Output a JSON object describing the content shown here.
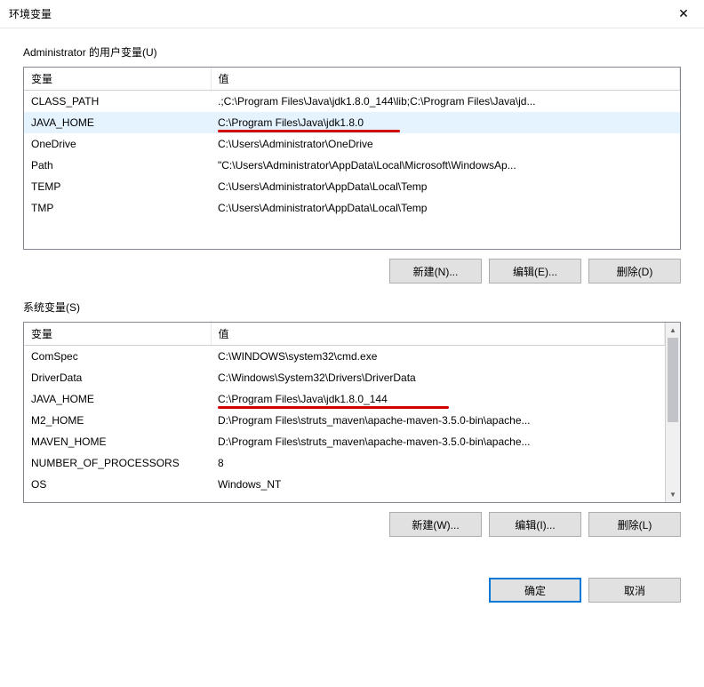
{
  "titlebar": {
    "title": "环境变量"
  },
  "userSection": {
    "label": "Administrator 的用户变量(U)",
    "columns": {
      "var": "变量",
      "val": "值"
    },
    "rows": [
      {
        "var": "CLASS_PATH",
        "val": ".;C:\\Program Files\\Java\\jdk1.8.0_144\\lib;C:\\Program Files\\Java\\jd..."
      },
      {
        "var": "JAVA_HOME",
        "val": "C:\\Program Files\\Java\\jdk1.8.0",
        "selected": true,
        "underline": 205
      },
      {
        "var": "OneDrive",
        "val": "C:\\Users\\Administrator\\OneDrive"
      },
      {
        "var": "Path",
        "val": "\"C:\\Users\\Administrator\\AppData\\Local\\Microsoft\\WindowsAp..."
      },
      {
        "var": "TEMP",
        "val": "C:\\Users\\Administrator\\AppData\\Local\\Temp"
      },
      {
        "var": "TMP",
        "val": "C:\\Users\\Administrator\\AppData\\Local\\Temp"
      }
    ],
    "buttons": {
      "new": "新建(N)...",
      "edit": "编辑(E)...",
      "del": "删除(D)"
    }
  },
  "sysSection": {
    "label": "系统变量(S)",
    "columns": {
      "var": "变量",
      "val": "值"
    },
    "rows": [
      {
        "var": "ComSpec",
        "val": "C:\\WINDOWS\\system32\\cmd.exe"
      },
      {
        "var": "DriverData",
        "val": "C:\\Windows\\System32\\Drivers\\DriverData"
      },
      {
        "var": "JAVA_HOME",
        "val": "C:\\Program Files\\Java\\jdk1.8.0_144",
        "underline": 260
      },
      {
        "var": "M2_HOME",
        "val": "D:\\Program Files\\struts_maven\\apache-maven-3.5.0-bin\\apache..."
      },
      {
        "var": "MAVEN_HOME",
        "val": "D:\\Program Files\\struts_maven\\apache-maven-3.5.0-bin\\apache..."
      },
      {
        "var": "NUMBER_OF_PROCESSORS",
        "val": "8"
      },
      {
        "var": "OS",
        "val": "Windows_NT"
      }
    ],
    "buttons": {
      "new": "新建(W)...",
      "edit": "编辑(I)...",
      "del": "删除(L)"
    }
  },
  "footer": {
    "ok": "确定",
    "cancel": "取消"
  }
}
